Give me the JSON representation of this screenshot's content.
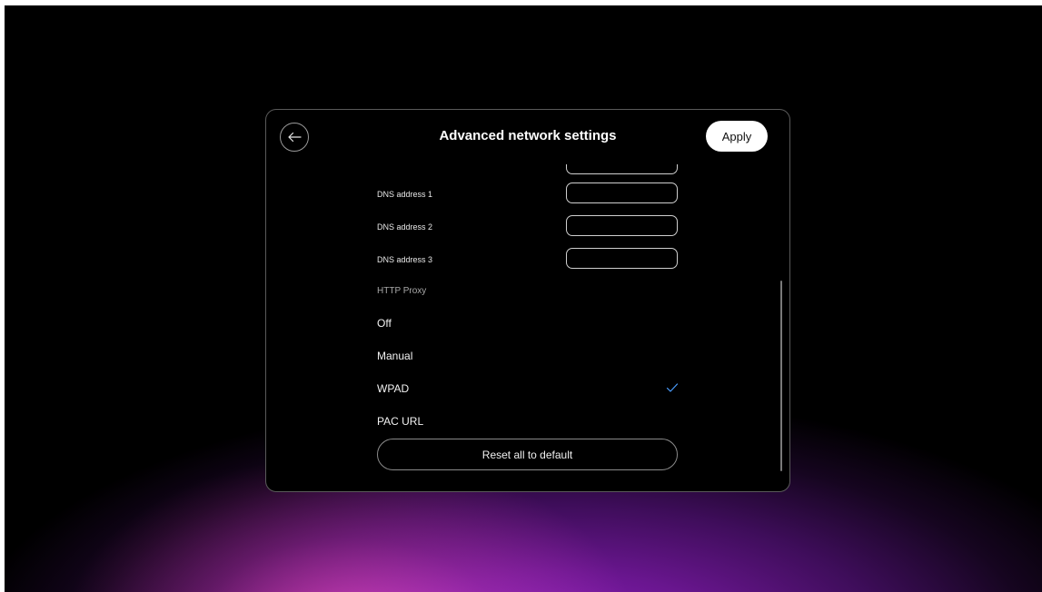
{
  "header": {
    "title": "Advanced network settings",
    "apply_label": "Apply",
    "back_icon": "arrow-left-icon"
  },
  "dns": [
    {
      "label": "DNS address 1",
      "value": ""
    },
    {
      "label": "DNS address 2",
      "value": ""
    },
    {
      "label": "DNS address 3",
      "value": ""
    }
  ],
  "http_proxy": {
    "section_label": "HTTP Proxy",
    "options": [
      {
        "label": "Off",
        "selected": false
      },
      {
        "label": "Manual",
        "selected": false
      },
      {
        "label": "WPAD",
        "selected": true
      },
      {
        "label": "PAC URL",
        "selected": false
      }
    ]
  },
  "reset_label": "Reset all to default",
  "colors": {
    "check": "#4a9eff",
    "panel_bg": "#000000",
    "apply_bg": "#ffffff"
  }
}
